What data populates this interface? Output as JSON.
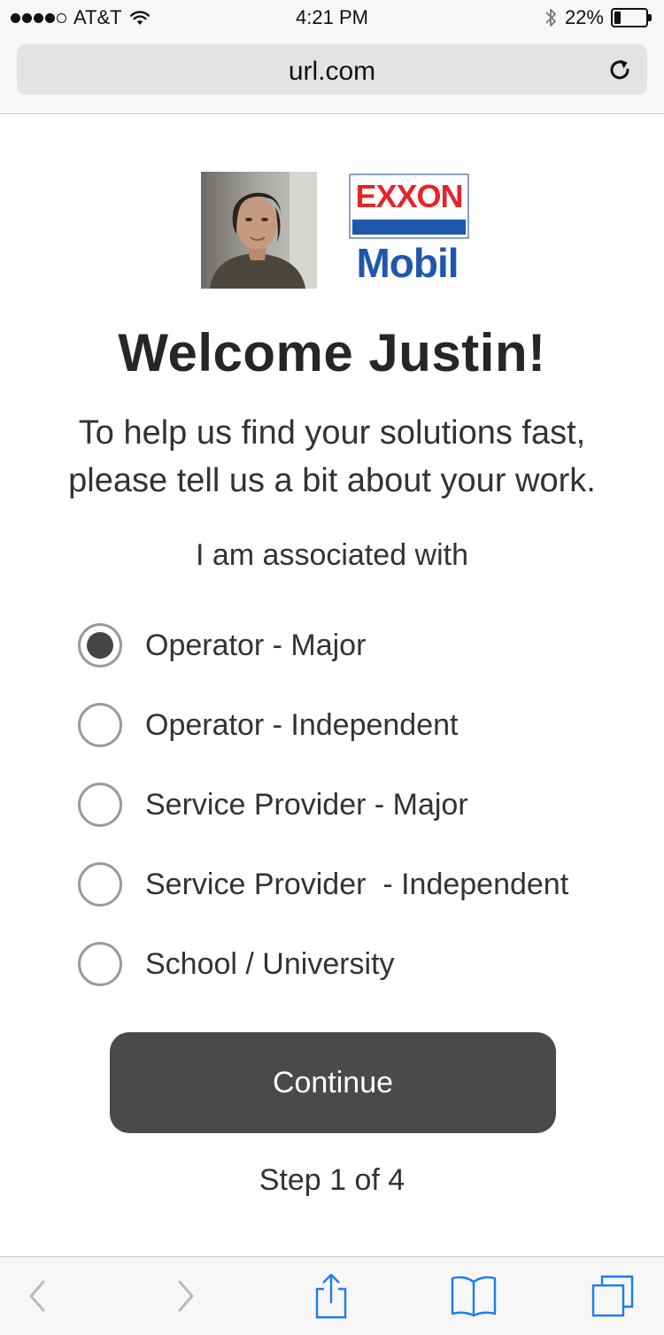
{
  "status_bar": {
    "carrier": "AT&T",
    "signal_bars": 4,
    "signal_total": 5,
    "time": "4:21 PM",
    "battery_percent": "22%",
    "battery_level": 0.22
  },
  "browser": {
    "url": "url.com"
  },
  "welcome": {
    "title": "Welcome Justin!",
    "intro_line1": "To help us find your solutions fast,",
    "intro_line2": "please tell us a bit about your work.",
    "association_label": "I am associated with"
  },
  "logo": {
    "top_text": "EXXON",
    "bottom_text": "Mobil",
    "colors": {
      "red": "#e8242a",
      "blue": "#1f57ad"
    }
  },
  "options": [
    {
      "label": "Operator - Major",
      "selected": true
    },
    {
      "label": "Operator - Independent",
      "selected": false
    },
    {
      "label": "Service Provider - Major",
      "selected": false
    },
    {
      "label": "Service Provider  - Independent",
      "selected": false
    },
    {
      "label": "School / University",
      "selected": false
    }
  ],
  "actions": {
    "continue_label": "Continue",
    "step_text": "Step 1 of 4"
  },
  "toolbar": {
    "icons": [
      "back-icon",
      "forward-icon",
      "share-icon",
      "bookmarks-icon",
      "tabs-icon"
    ],
    "accent_color": "#1a7cf7",
    "disabled_color": "#b9b9be"
  }
}
